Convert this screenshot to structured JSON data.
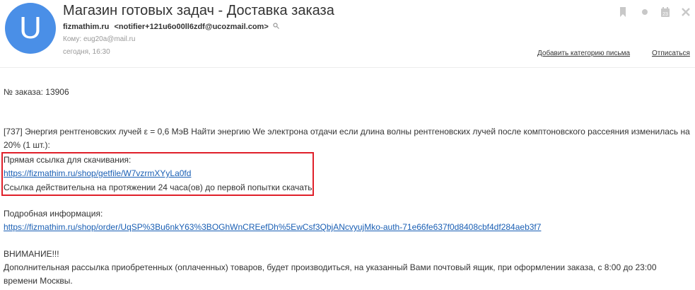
{
  "header": {
    "avatar_letter": "U",
    "subject": "Магазин готовых задач - Доставка заказа",
    "sender_name": "fizmathim.ru",
    "sender_address": "<notifier+121u6o00ll6zdf@ucozmail.com>",
    "to_label": "Кому:",
    "to_value": "eug20a@mail.ru",
    "date": "сегодня, 16:30",
    "add_category": "Добавить категорию письма",
    "unsubscribe": "Отписаться",
    "calendar_day": "23",
    "icons": [
      "bookmark-icon",
      "dot-icon",
      "calendar-icon",
      "delete-icon",
      "search-icon"
    ],
    "accent_color": "#4a8fe7"
  },
  "body": {
    "order_number": "№ заказа: 13906",
    "item_line1": "[737] Энергия рентгеновских лучей ε = 0,6 МэВ Найти энергию We электрона отдачи если длина волны рентгеновских лучей после комптоновского рассеяния изменилась на",
    "item_line2": "20% (1 шт.):",
    "direct_link_label": "Прямая ссылка для скачивания:",
    "direct_link": "https://fizmathim.ru/shop/getfile/W7vzrmXYyLa0fd",
    "validity": "Ссылка действительна на протяжении 24 часа(ов) до первой попытки скачать",
    "details_label": "Подробная информация:",
    "details_link": "https://fizmathim.ru/shop/order/UqSP%3Bu6nkY63%3BOGhWnCREefDh%5EwCsf3QbjANcvyujMko-auth-71e66fe637f0d8408cbf4df284aeb3f7",
    "warning_title": "ВНИМАНИЕ!!!",
    "warning_line1": "Дополнительная рассылка приобретенных (оплаченных) товаров, будет производиться, на указанный Вами почтовый ящик, при оформлении заказа, с 8:00 до 23:00",
    "warning_line2": "времени Москвы.",
    "highlight_color": "#e0202a",
    "link_color": "#1a5fb4"
  }
}
